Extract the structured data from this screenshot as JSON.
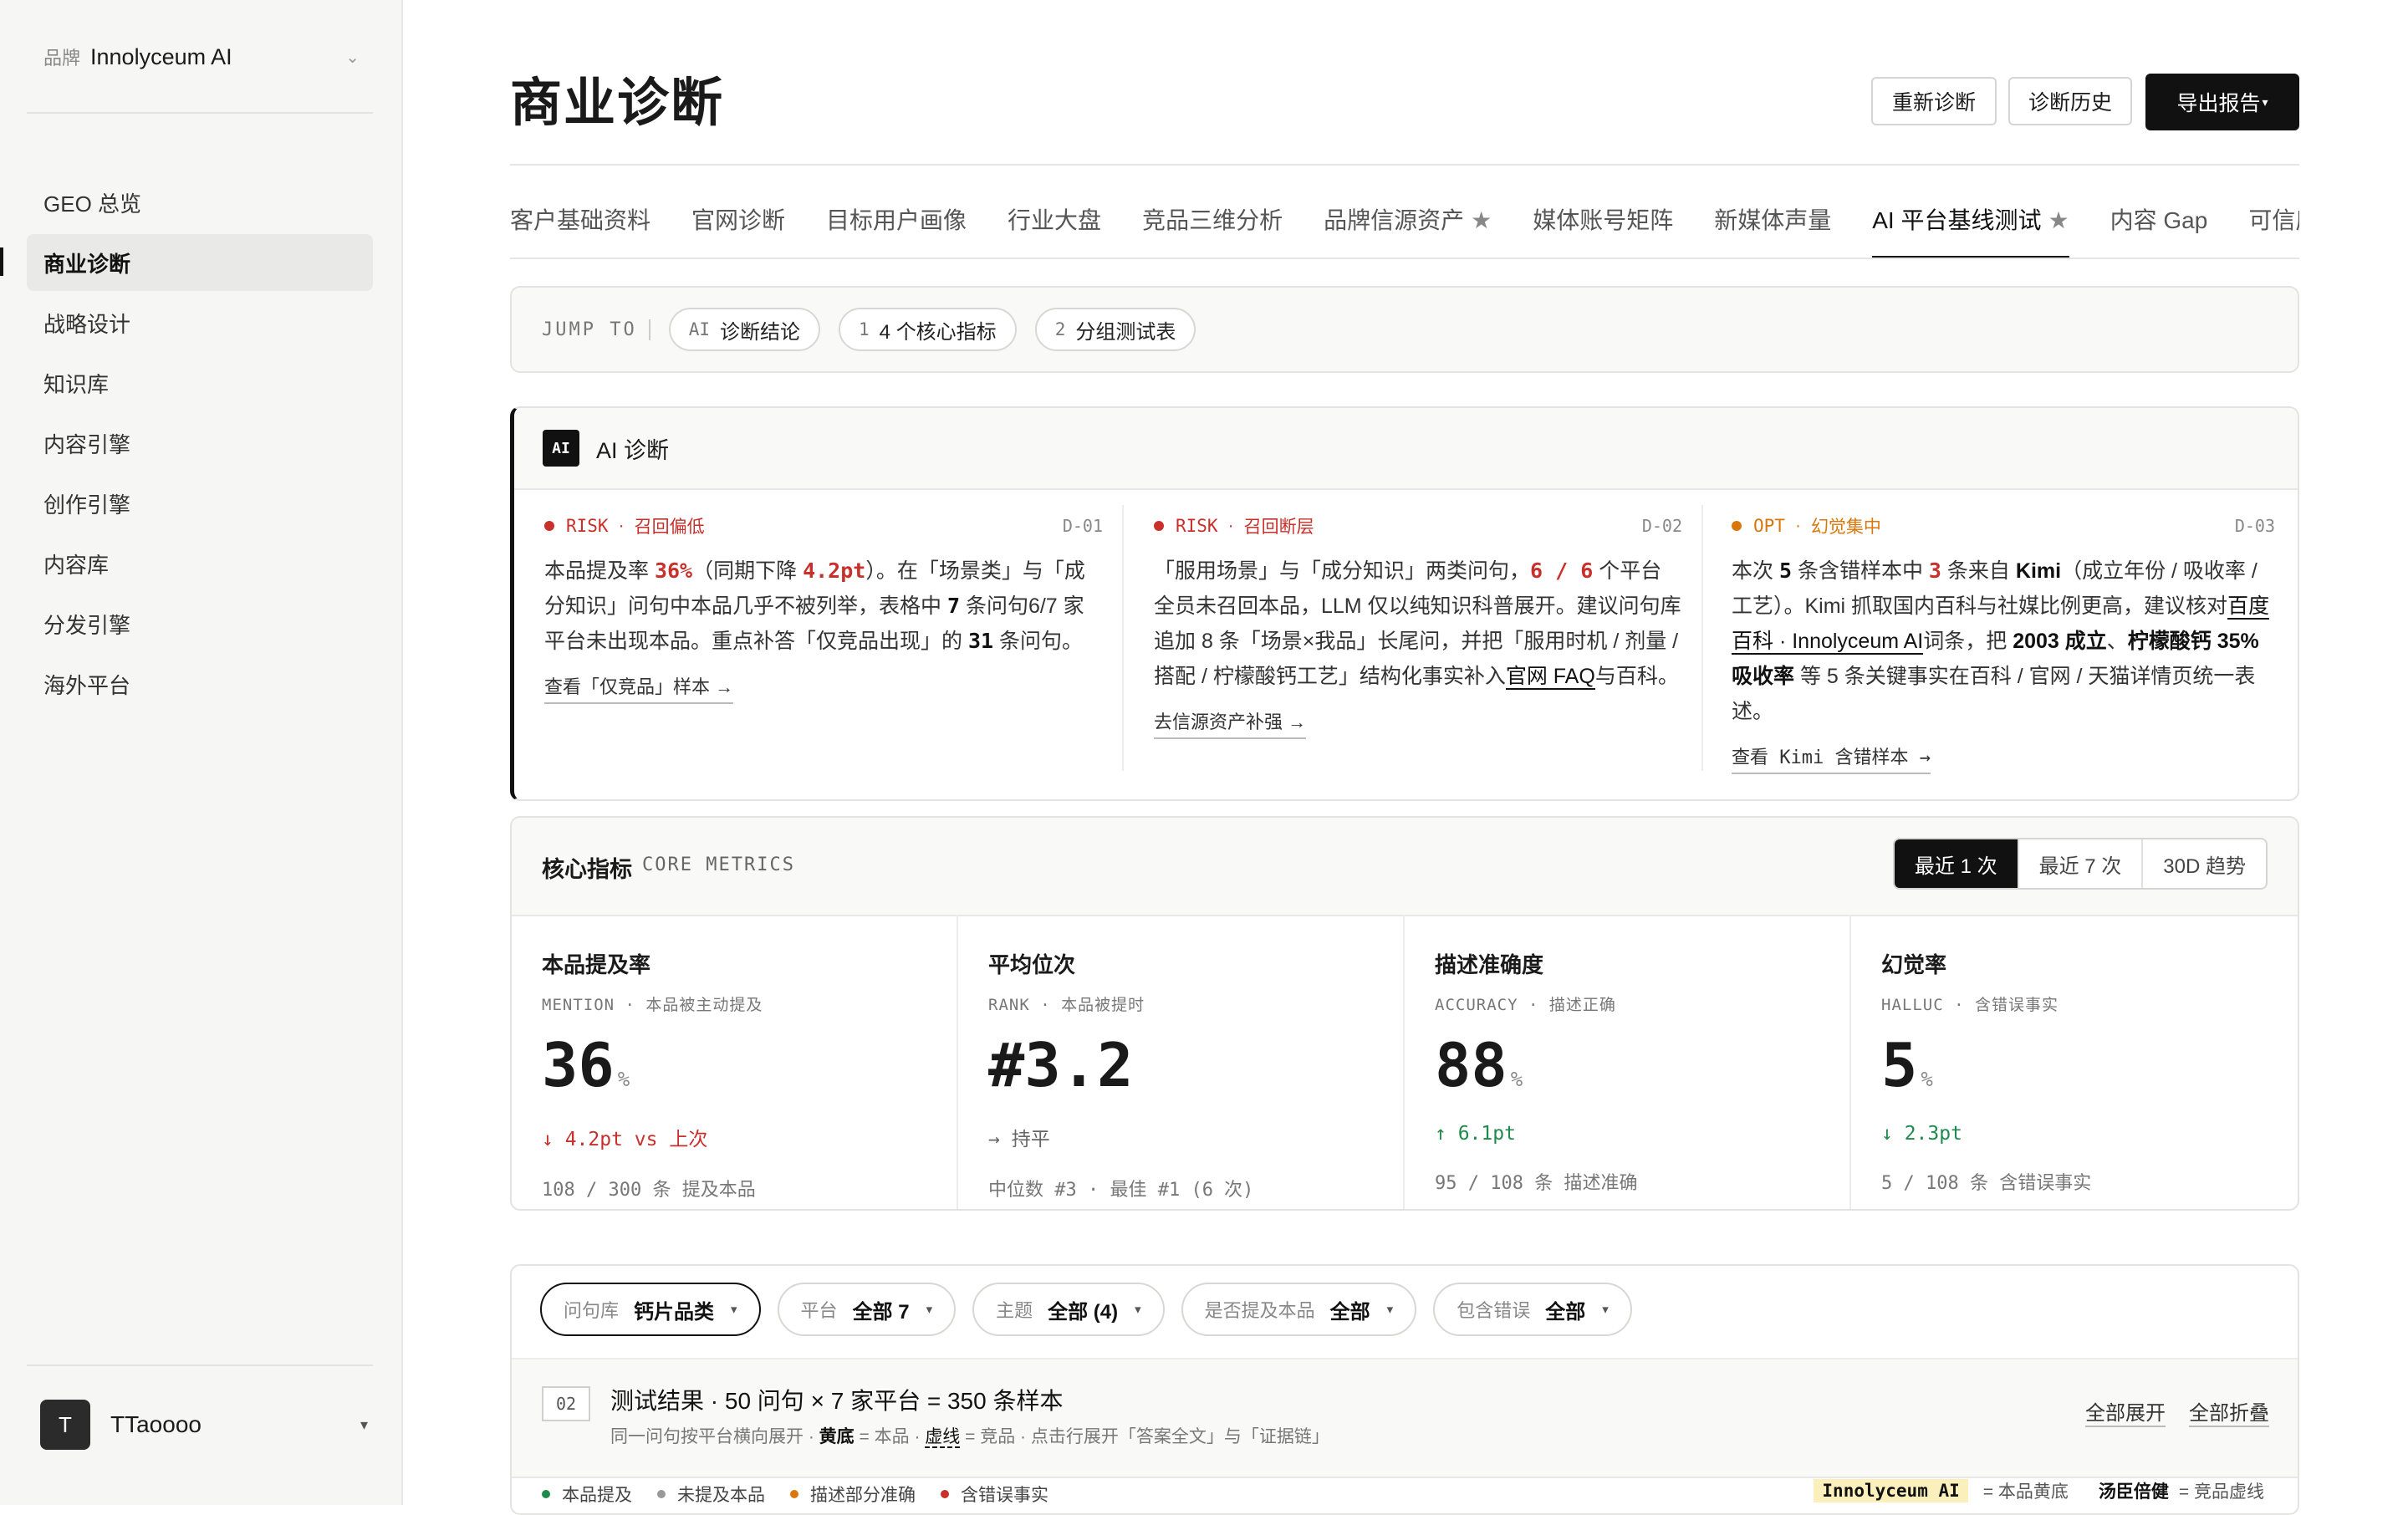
{
  "sidebar": {
    "brand_label": "品牌",
    "brand_name": "Innolyceum AI",
    "items": [
      {
        "label": "GEO 总览"
      },
      {
        "label": "商业诊断"
      },
      {
        "label": "战略设计"
      },
      {
        "label": "知识库"
      },
      {
        "label": "内容引擎"
      },
      {
        "label": "创作引擎"
      },
      {
        "label": "内容库"
      },
      {
        "label": "分发引擎"
      },
      {
        "label": "海外平台"
      }
    ],
    "active_item": "商业诊断",
    "user_initial": "T",
    "user_name": "TTaoooo"
  },
  "header": {
    "title": "商业诊断",
    "rediagnose_label": "重新诊断",
    "history_label": "诊断历史",
    "export_label": "导出报告"
  },
  "tabs": [
    {
      "label": "客户基础资料",
      "star": false
    },
    {
      "label": "官网诊断",
      "star": false
    },
    {
      "label": "目标用户画像",
      "star": false
    },
    {
      "label": "行业大盘",
      "star": false
    },
    {
      "label": "竞品三维分析",
      "star": false
    },
    {
      "label": "品牌信源资产",
      "star": true
    },
    {
      "label": "媒体账号矩阵",
      "star": false
    },
    {
      "label": "新媒体声量",
      "star": false
    },
    {
      "label": "AI 平台基线测试",
      "star": true,
      "active": true
    },
    {
      "label": "内容 Gap",
      "star": false
    },
    {
      "label": "可信度",
      "star": false
    }
  ],
  "jump": {
    "label": "JUMP TO",
    "items": [
      {
        "num": "AI",
        "label": "诊断结论"
      },
      {
        "num": "1",
        "label": "4 个核心指标"
      },
      {
        "num": "2",
        "label": "分组测试表"
      }
    ]
  },
  "ai_diagnosis": {
    "badge": "AI",
    "title": "AI 诊断",
    "cards": [
      {
        "level": "RISK",
        "dot": "·",
        "topic": "召回偏低",
        "code": "D-01",
        "p1": "本品提及率 ",
        "v1": "36%",
        "p2": "（同期下降 ",
        "v2": "4.2pt",
        "p3": "）。在「场景类」与「成分知识」问句中本品几乎不被列举，表格中 ",
        "b1": "7",
        "p4": " 条问句6/7 家平台未出现本品。重点补答「仅竞品出现」的 ",
        "b2": "31",
        "p5": " 条问句。",
        "link": "查看「仅竞品」样本 →"
      },
      {
        "level": "RISK",
        "dot": "·",
        "topic": "召回断层",
        "code": "D-02",
        "p1": "「服用场景」与「成分知识」两类问句，",
        "v1": "6 / 6",
        "p2": " 个平台全员未召回本品，LLM 仅以纯知识科普展开。建议问句库追加 8 条「场景×我品」长尾问，并把「服用时机 / 剂量 / 搭配 / 柠檬酸钙工艺」结构化事实补入",
        "u1": "官网 FAQ",
        "p3": "与百科。",
        "link": "去信源资产补强 →"
      },
      {
        "level": "OPT",
        "dot": "·",
        "topic": "幻觉集中",
        "code": "D-03",
        "p1": "本次 ",
        "b1": "5",
        "p2": " 条含错样本中 ",
        "v1": "3",
        "p3": " 条来自 ",
        "b2": "Kimi",
        "p4": "（成立年份 / 吸收率 / 工艺）。Kimi 抓取国内百科与社媒比例更高，建议核对",
        "u1": "百度百科 · Innolyceum AI",
        "p5": "词条，把 ",
        "b3": "2003 成立",
        "p6": "、",
        "b4": "柠檬酸钙 35% 吸收率",
        "p7": " 等 5 条关键事实在百科 / 官网 / 天猫详情页统一表述。",
        "link": "查看 Kimi 含错样本 →"
      }
    ]
  },
  "metrics": {
    "title": "核心指标",
    "subtitle": "CORE METRICS",
    "ranges": [
      "最近 1 次",
      "最近 7 次",
      "30D 趋势"
    ],
    "active_range": "最近 1 次",
    "cards": [
      {
        "name": "本品提及率",
        "sub": "MENTION · 本品被主动提及",
        "value": "36",
        "unit": "%",
        "delta": "↓ 4.2pt vs 上次",
        "trend": "down",
        "foot": "108 / 300 条 提及本品"
      },
      {
        "name": "平均位次",
        "sub": "RANK · 本品被提时",
        "value": "#3.2",
        "unit": "",
        "delta": "→ 持平",
        "trend": "flat",
        "foot": "中位数 #3 · 最佳 #1 (6 次)"
      },
      {
        "name": "描述准确度",
        "sub": "ACCURACY · 描述正确",
        "value": "88",
        "unit": "%",
        "delta": "↑ 6.1pt",
        "trend": "up",
        "foot": "95 / 108 条 描述准确"
      },
      {
        "name": "幻觉率",
        "sub": "HALLUC · 含错误事实",
        "value": "5",
        "unit": "%",
        "delta": "↓ 2.3pt",
        "trend": "up",
        "foot": "5 / 108 条 含错误事实"
      }
    ]
  },
  "filters": [
    {
      "key": "问句库",
      "value": "钙片品类"
    },
    {
      "key": "平台",
      "value": "全部 7"
    },
    {
      "key": "主题",
      "value": "全部 (4)"
    },
    {
      "key": "是否提及本品",
      "value": "全部"
    },
    {
      "key": "包含错误",
      "value": "全部"
    }
  ],
  "test_results": {
    "num": "02",
    "title": "测试结果 · 50 问句 × 7 家平台 = 350 条样本",
    "sub_1": "同一问句按平台横向展开 · ",
    "sub_bold": "黄底",
    "sub_2": " = 本品 · ",
    "sub_dash": "虚线",
    "sub_3": " = 竞品 · 点击行展开「答案全文」与「证据链」",
    "expand_all": "全部展开",
    "collapse_all": "全部折叠",
    "legend": [
      {
        "label": "本品提及",
        "color": "#1f8a4c"
      },
      {
        "label": "未提及本品",
        "color": "#999999"
      },
      {
        "label": "描述部分准确",
        "color": "#d9770d"
      },
      {
        "label": "含错误事实",
        "color": "#c8302c"
      }
    ],
    "legend_hl": "Innolyceum AI",
    "legend_hl_text": "= 本品黄底",
    "legend_comp": "汤臣倍健",
    "legend_comp_text": "= 竞品虚线"
  }
}
